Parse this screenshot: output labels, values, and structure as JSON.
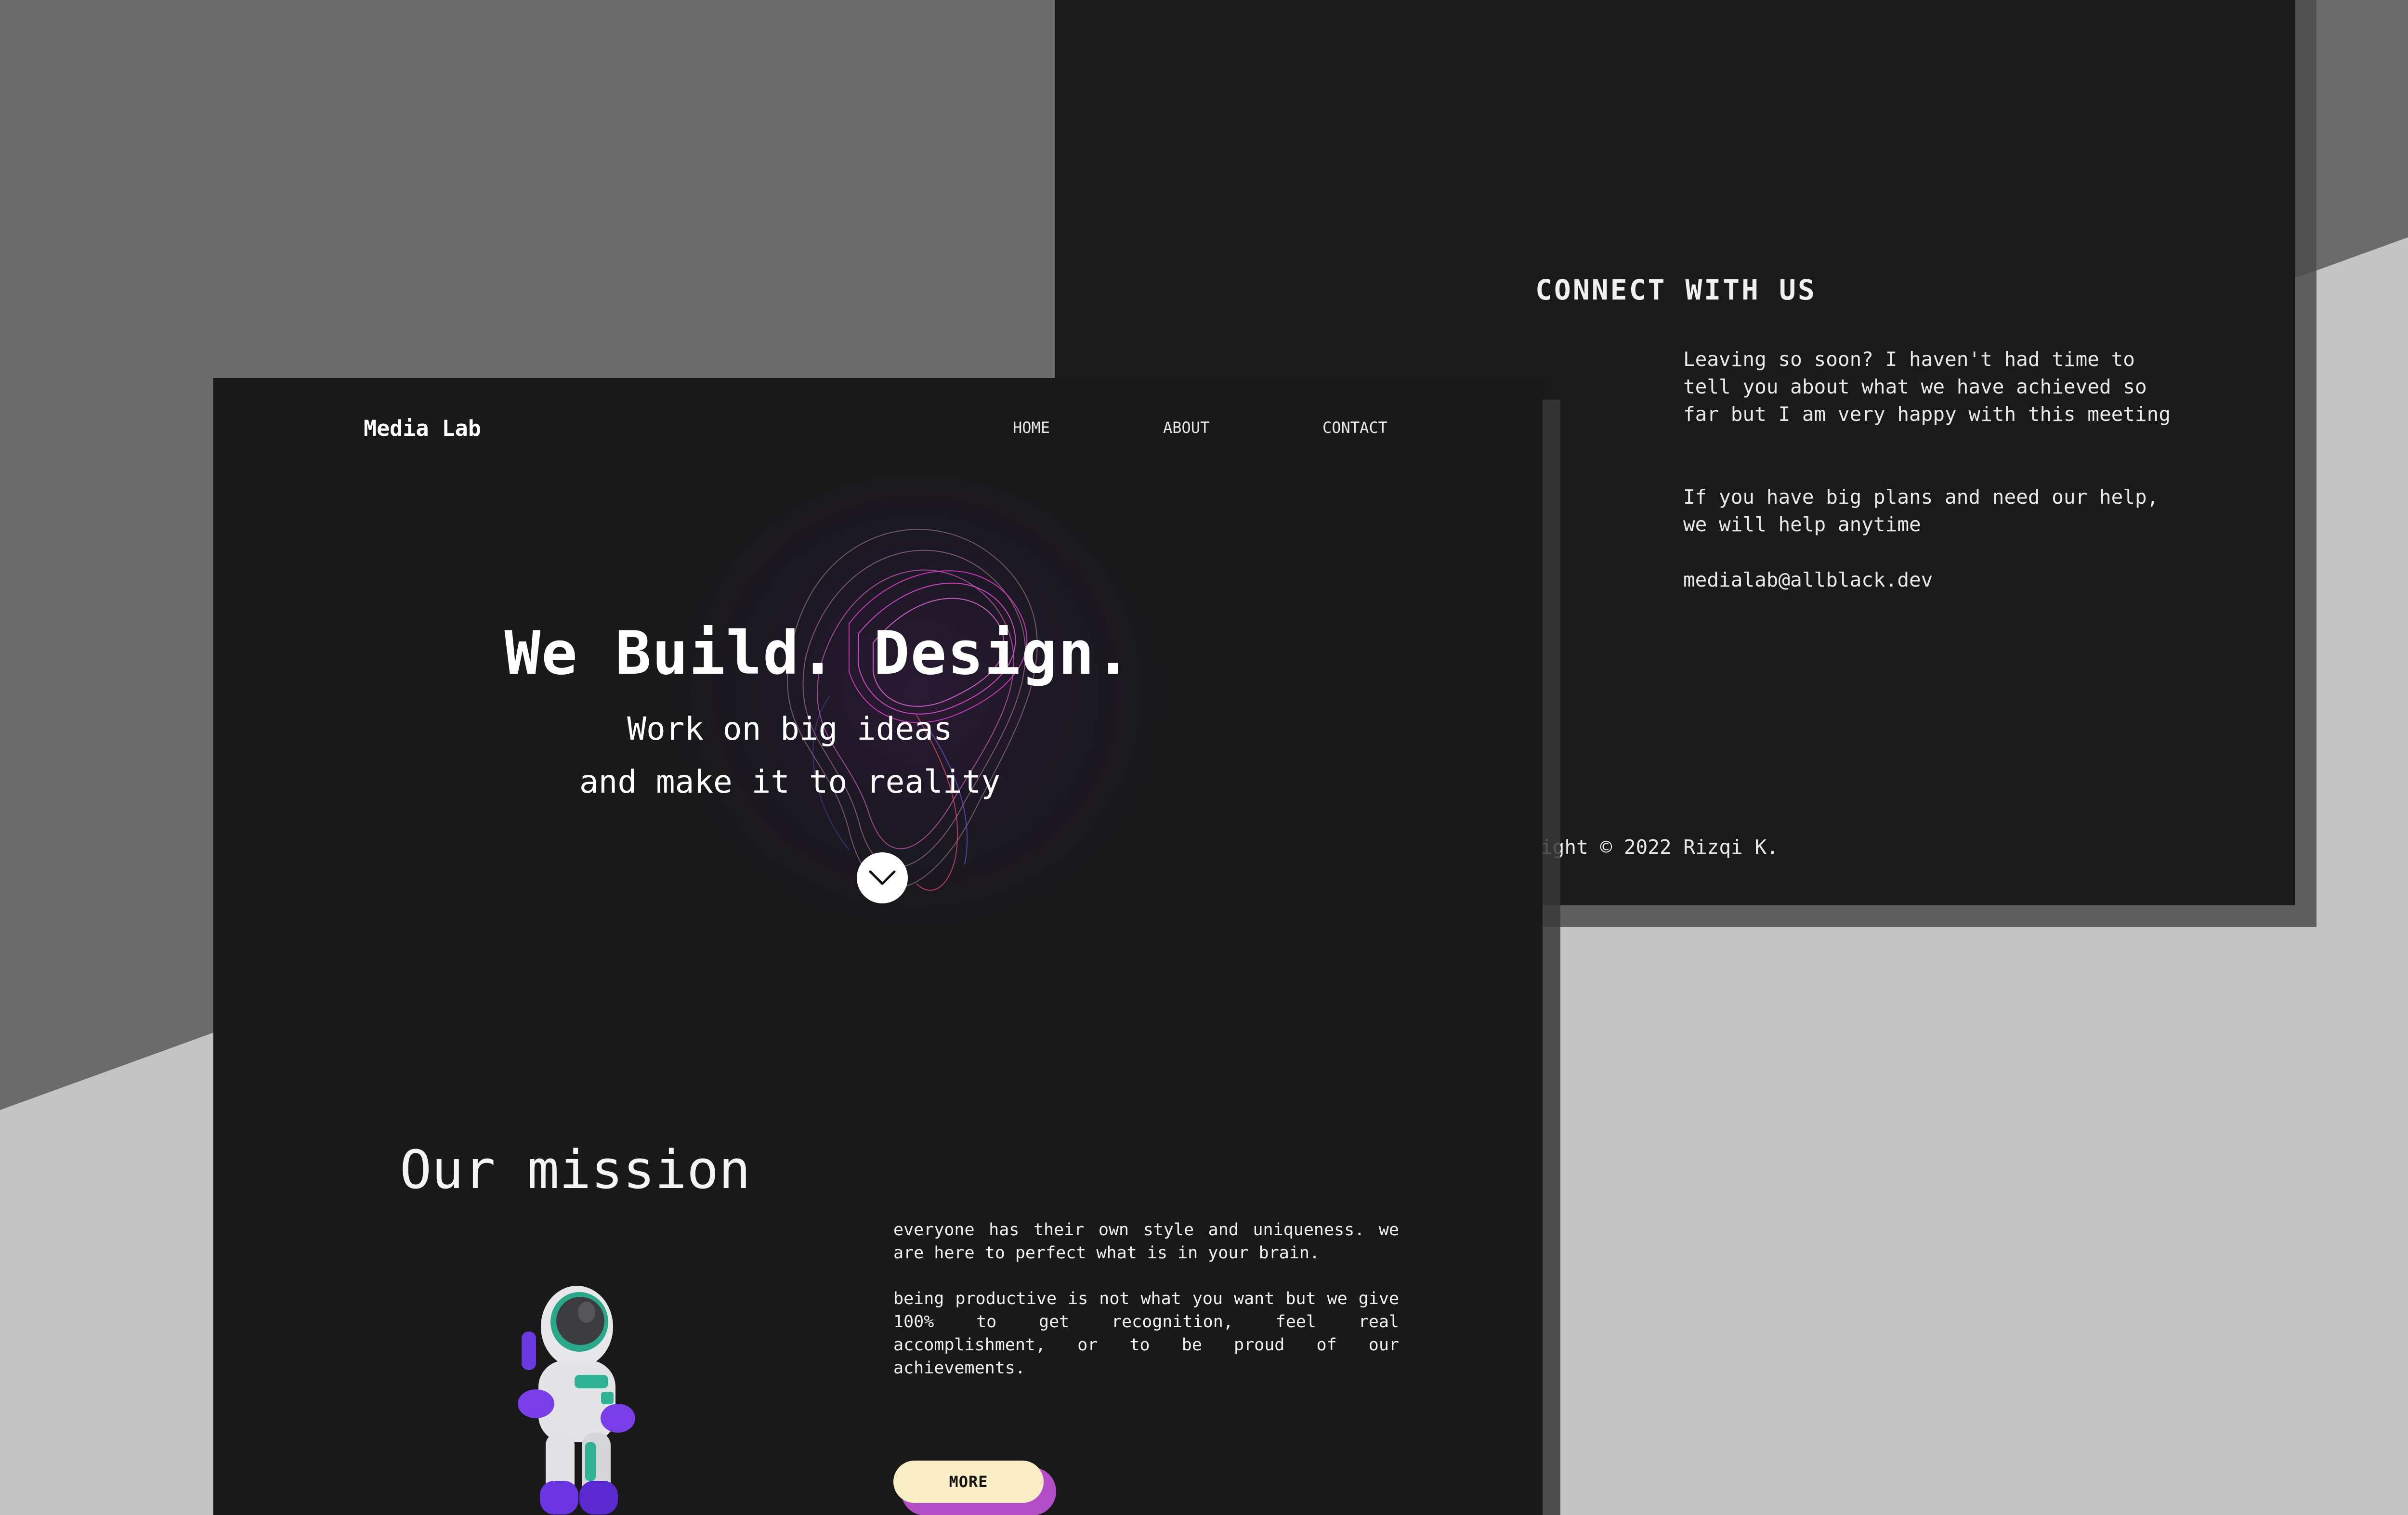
{
  "site": {
    "logo": "Media Lab",
    "nav": [
      {
        "label": "HOME"
      },
      {
        "label": "ABOUT"
      },
      {
        "label": "CONTACT"
      }
    ]
  },
  "hero": {
    "title": "We Build. Design.",
    "subtitle_line1": "Work on big ideas",
    "subtitle_line2": "and make it to reality",
    "scroll_icon": "chevron-down-icon"
  },
  "mission": {
    "title": "Our mission",
    "paragraph1": "everyone has their own style and uniqueness. we are here to perfect what is in your brain.",
    "paragraph2": "being productive is not what you want but we give 100% to get recognition, feel real accomplishment, or to be proud of our achievements.",
    "button_label": "MORE",
    "illustration": "astronaut-illustration"
  },
  "contact": {
    "title": "CONNECT WITH US",
    "paragraph1": "Leaving so soon? I haven't had time to tell you about what we have achieved so far but I am very happy with this meeting",
    "paragraph2": "If you have big plans and need our help, we will help anytime",
    "email": "medialab@allblack.dev",
    "copyright": "pyright © 2022 Rizqi K."
  },
  "colors": {
    "card_background": "#19191a",
    "backdrop_dark": "#6b6b6b",
    "backdrop_light": "#c4c4c4",
    "button_fill": "#f8edc4",
    "button_shadow": "#b44ec8",
    "accent_magenta": "#d63adf"
  }
}
